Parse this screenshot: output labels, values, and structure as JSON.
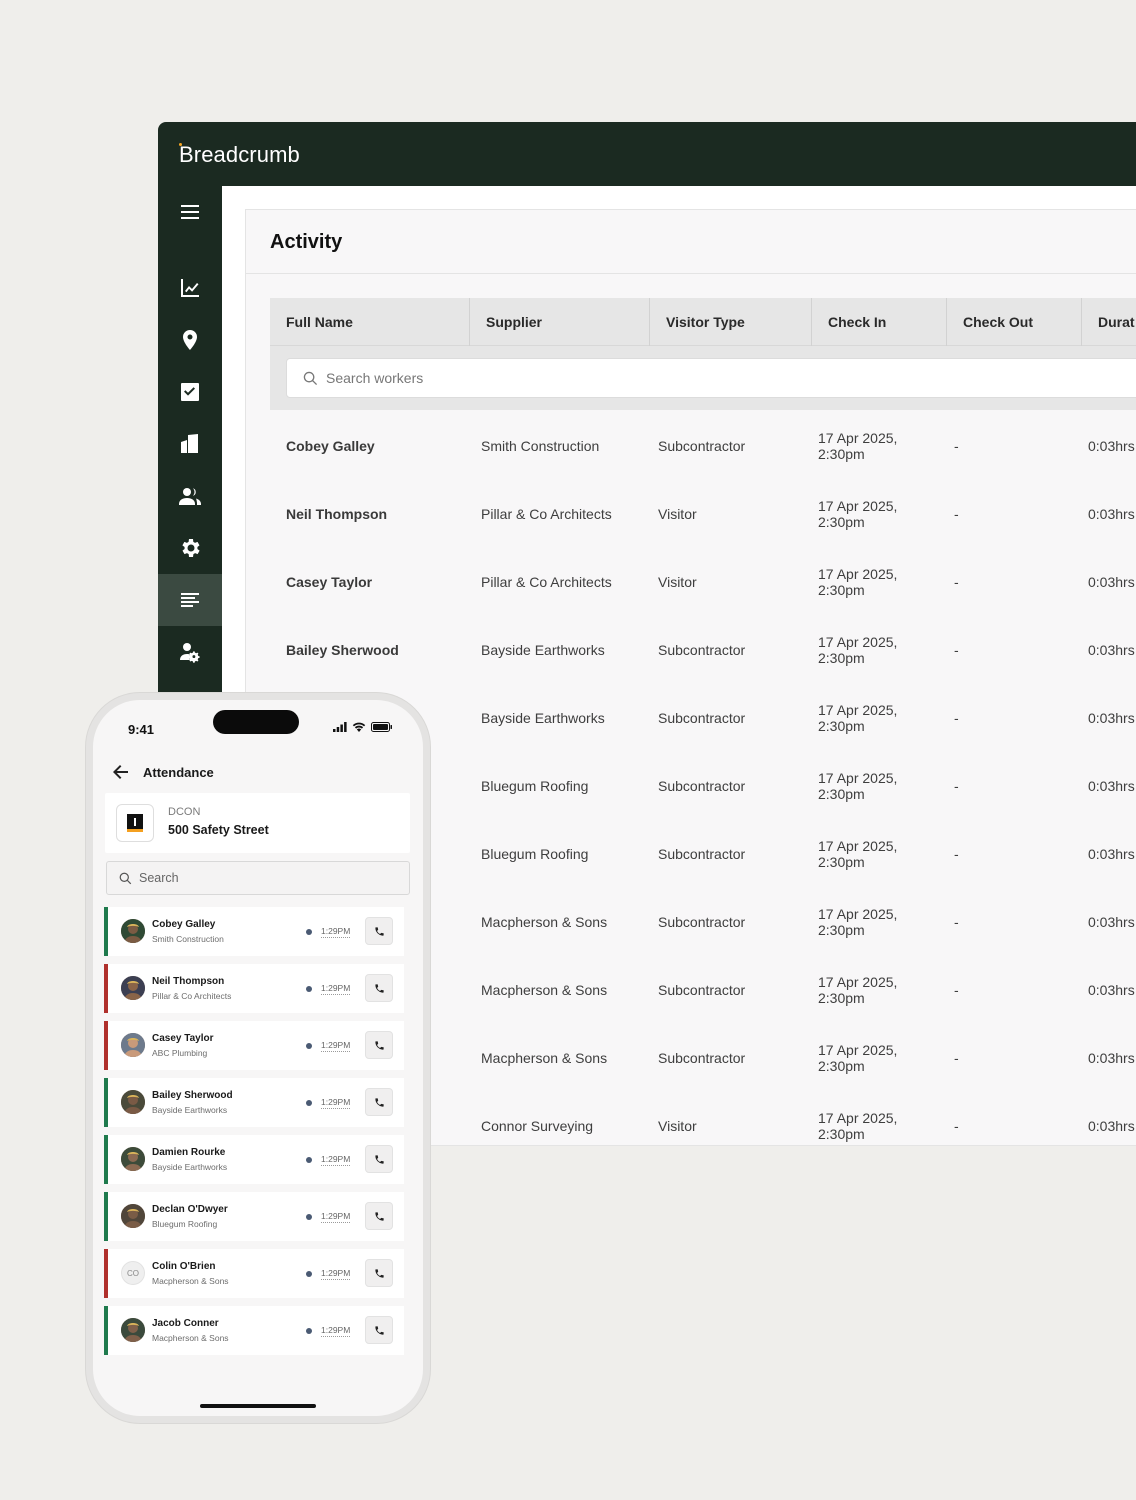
{
  "app": {
    "brand": "Breadcrumb"
  },
  "sidebar": {
    "items": [
      {
        "name": "menu-icon"
      },
      {
        "name": "analytics-icon"
      },
      {
        "name": "location-icon"
      },
      {
        "name": "tasks-icon"
      },
      {
        "name": "buildings-icon"
      },
      {
        "name": "people-icon"
      },
      {
        "name": "settings-icon"
      },
      {
        "name": "activity-icon",
        "active": true
      },
      {
        "name": "user-admin-icon"
      }
    ]
  },
  "activity": {
    "title": "Activity",
    "columns": [
      "Full Name",
      "Supplier",
      "Visitor Type",
      "Check In",
      "Check Out",
      "Durat"
    ],
    "search": {
      "placeholder": "Search workers"
    },
    "rows": [
      {
        "name": "Cobey Galley",
        "supplier": "Smith Construction",
        "type": "Subcontractor",
        "check_in": "17 Apr 2025, 2:30pm",
        "check_out": "-",
        "duration": "0:03hrs"
      },
      {
        "name": "Neil Thompson",
        "supplier": "Pillar & Co Architects",
        "type": "Visitor",
        "check_in": "17 Apr 2025, 2:30pm",
        "check_out": "-",
        "duration": "0:03hrs"
      },
      {
        "name": "Casey Taylor",
        "supplier": "Pillar & Co Architects",
        "type": "Visitor",
        "check_in": "17 Apr 2025, 2:30pm",
        "check_out": "-",
        "duration": "0:03hrs"
      },
      {
        "name": "Bailey Sherwood",
        "supplier": "Bayside Earthworks",
        "type": "Subcontractor",
        "check_in": "17 Apr 2025, 2:30pm",
        "check_out": "-",
        "duration": "0:03hrs"
      },
      {
        "name": "",
        "supplier": "Bayside Earthworks",
        "type": "Subcontractor",
        "check_in": "17 Apr 2025, 2:30pm",
        "check_out": "-",
        "duration": "0:03hrs"
      },
      {
        "name": "",
        "supplier": "Bluegum Roofing",
        "type": "Subcontractor",
        "check_in": "17 Apr 2025, 2:30pm",
        "check_out": "-",
        "duration": "0:03hrs"
      },
      {
        "name": "",
        "supplier": "Bluegum Roofing",
        "type": "Subcontractor",
        "check_in": "17 Apr 2025, 2:30pm",
        "check_out": "-",
        "duration": "0:03hrs"
      },
      {
        "name": "",
        "supplier": "Macpherson & Sons",
        "type": "Subcontractor",
        "check_in": "17 Apr 2025, 2:30pm",
        "check_out": "-",
        "duration": "0:03hrs"
      },
      {
        "name": "",
        "supplier": "Macpherson & Sons",
        "type": "Subcontractor",
        "check_in": "17 Apr 2025, 2:30pm",
        "check_out": "-",
        "duration": "0:03hrs"
      },
      {
        "name": "",
        "supplier": "Macpherson & Sons",
        "type": "Subcontractor",
        "check_in": "17 Apr 2025, 2:30pm",
        "check_out": "-",
        "duration": "0:03hrs"
      },
      {
        "name": "",
        "supplier": "Connor Surveying",
        "type": "Visitor",
        "check_in": "17 Apr 2025, 2:30pm",
        "check_out": "-",
        "duration": "0:03hrs"
      }
    ]
  },
  "phone": {
    "status_time": "9:41",
    "title": "Attendance",
    "site": {
      "code": "DCON",
      "address": "500 Safety Street"
    },
    "search": {
      "placeholder": "Search"
    },
    "workers": [
      {
        "name": "Cobey Galley",
        "supplier": "Smith Construction",
        "time": "1:29PM",
        "status": "green",
        "avatar": "photo"
      },
      {
        "name": "Neil Thompson",
        "supplier": "Pillar & Co Architects",
        "time": "1:29PM",
        "status": "red",
        "avatar": "photo"
      },
      {
        "name": "Casey Taylor",
        "supplier": "ABC Plumbing",
        "time": "1:29PM",
        "status": "red",
        "avatar": "photo"
      },
      {
        "name": "Bailey Sherwood",
        "supplier": "Bayside Earthworks",
        "time": "1:29PM",
        "status": "green",
        "avatar": "photo"
      },
      {
        "name": "Damien Rourke",
        "supplier": "Bayside Earthworks",
        "time": "1:29PM",
        "status": "green",
        "avatar": "photo"
      },
      {
        "name": "Declan O'Dwyer",
        "supplier": "Bluegum Roofing",
        "time": "1:29PM",
        "status": "green",
        "avatar": "photo"
      },
      {
        "name": "Colin O'Brien",
        "supplier": "Macpherson & Sons",
        "time": "1:29PM",
        "status": "red",
        "avatar": "CO"
      },
      {
        "name": "Jacob Conner",
        "supplier": "Macpherson & Sons",
        "time": "1:29PM",
        "status": "green",
        "avatar": "photo"
      }
    ]
  },
  "colors": {
    "sidebar_bg": "#1b2a21",
    "status_green": "#1f7a4d",
    "status_red": "#b0302c",
    "accent": "#f6a623"
  }
}
